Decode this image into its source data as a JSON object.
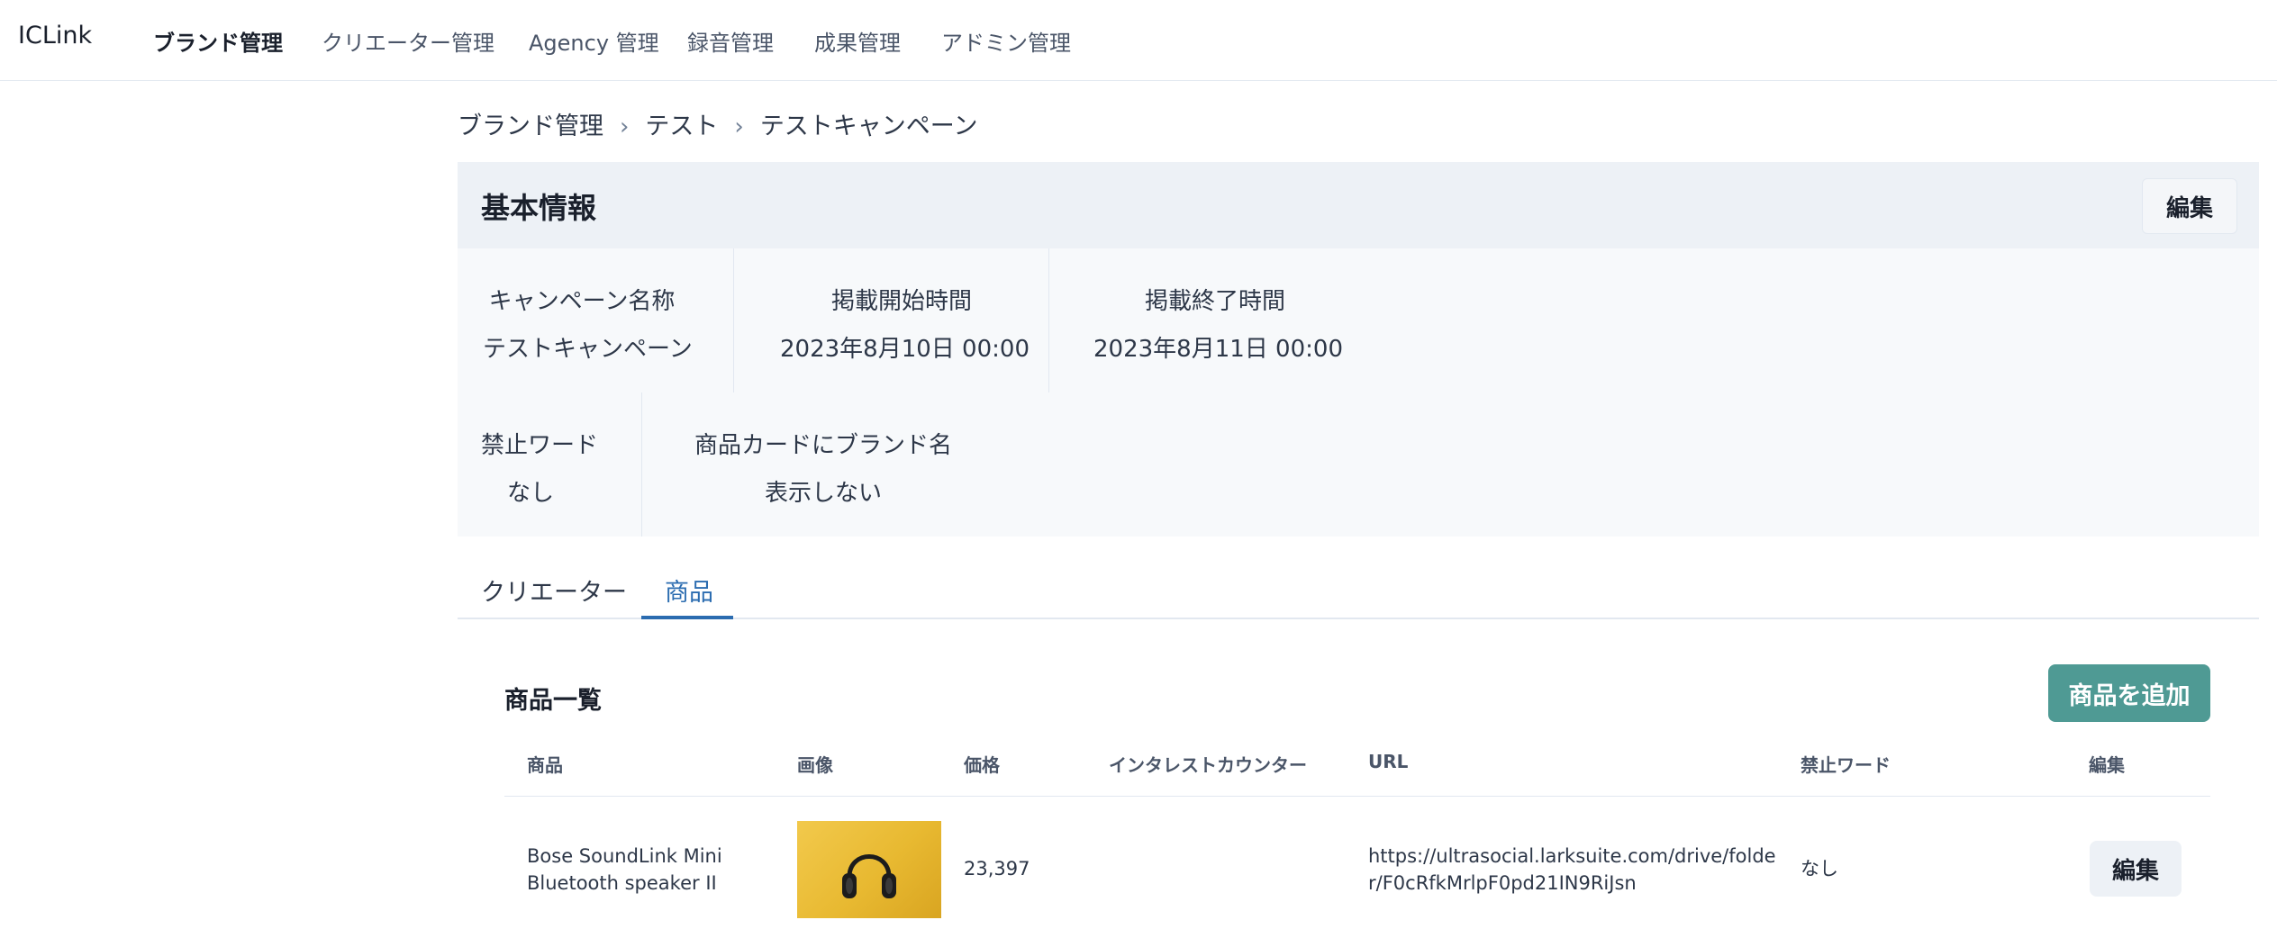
{
  "app": {
    "logo": "ICLink"
  },
  "nav": {
    "items": [
      {
        "label": "ブランド管理",
        "active": true
      },
      {
        "label": "クリエーター管理"
      },
      {
        "label": "Agency 管理"
      },
      {
        "label": "録音管理"
      },
      {
        "label": "成果管理"
      },
      {
        "label": "アドミン管理"
      }
    ]
  },
  "breadcrumb": {
    "items": [
      "ブランド管理",
      "テスト",
      "テストキャンペーン"
    ],
    "separator": "›"
  },
  "basic_info": {
    "title": "基本情報",
    "edit_label": "編集",
    "fields": [
      {
        "label": "キャンペーン名称",
        "value": "テストキャンペーン"
      },
      {
        "label": "掲載開始時間",
        "value": "2023年8月10日 00:00"
      },
      {
        "label": "掲載終了時間",
        "value": "2023年8月11日 00:00"
      },
      {
        "label": "禁止ワード",
        "value": "なし"
      },
      {
        "label": "商品カードにブランド名",
        "value": "表示しない"
      }
    ]
  },
  "tabs": [
    {
      "label": "クリエーター"
    },
    {
      "label": "商品",
      "active": true
    }
  ],
  "products": {
    "title": "商品一覧",
    "add_label": "商品を追加",
    "columns": [
      "商品",
      "画像",
      "価格",
      "インタレストカウンター",
      "URL",
      "禁止ワード",
      "編集"
    ],
    "rows": [
      {
        "name_line1": "Bose SoundLink Mini",
        "name_line2": "Bluetooth speaker II",
        "image_icon": "headphones-icon",
        "price": "23,397",
        "interest_counter": "",
        "url_line1": "https://ultrasocial.larksuite.com/drive/folde",
        "url_line2": "r/F0cRfkMrlpF0pd21IN9RiJsn",
        "forbidden": "なし",
        "edit_label": "編集"
      }
    ]
  },
  "colors": {
    "accent": "#2b6cb0",
    "add_button": "#4f9a94",
    "header_bg": "#edf1f6",
    "card_bg": "#f7f9fb"
  }
}
